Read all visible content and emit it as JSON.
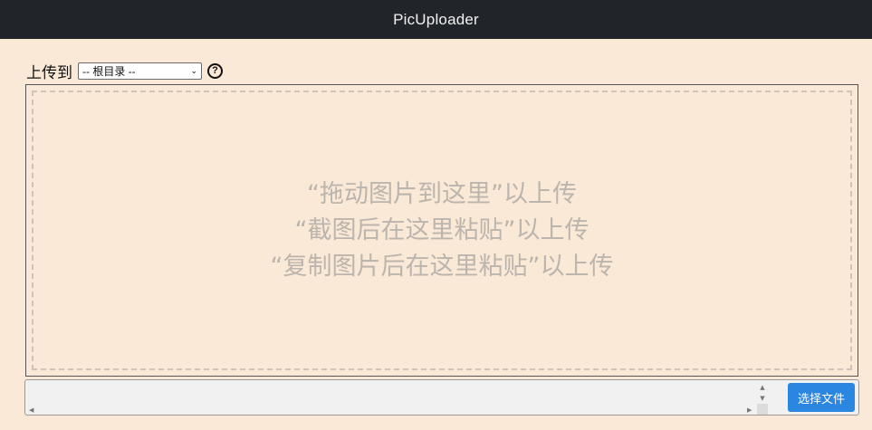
{
  "header": {
    "title": "PicUploader"
  },
  "upload": {
    "label": "上传到",
    "directory_selected": "-- 根目录 --",
    "help_icon": "question-circle-icon"
  },
  "dropzone": {
    "lines": [
      "“拖动图片到这里”以上传",
      "“截图后在这里粘贴”以上传",
      "“复制图片后在这里粘贴”以上传"
    ]
  },
  "file_input": {
    "value": "",
    "button_label": "选择文件"
  },
  "colors": {
    "background": "#fbe9d7",
    "header_bg": "#212529",
    "accent": "#2b86e2",
    "hint_text": "#bcb5ad"
  }
}
